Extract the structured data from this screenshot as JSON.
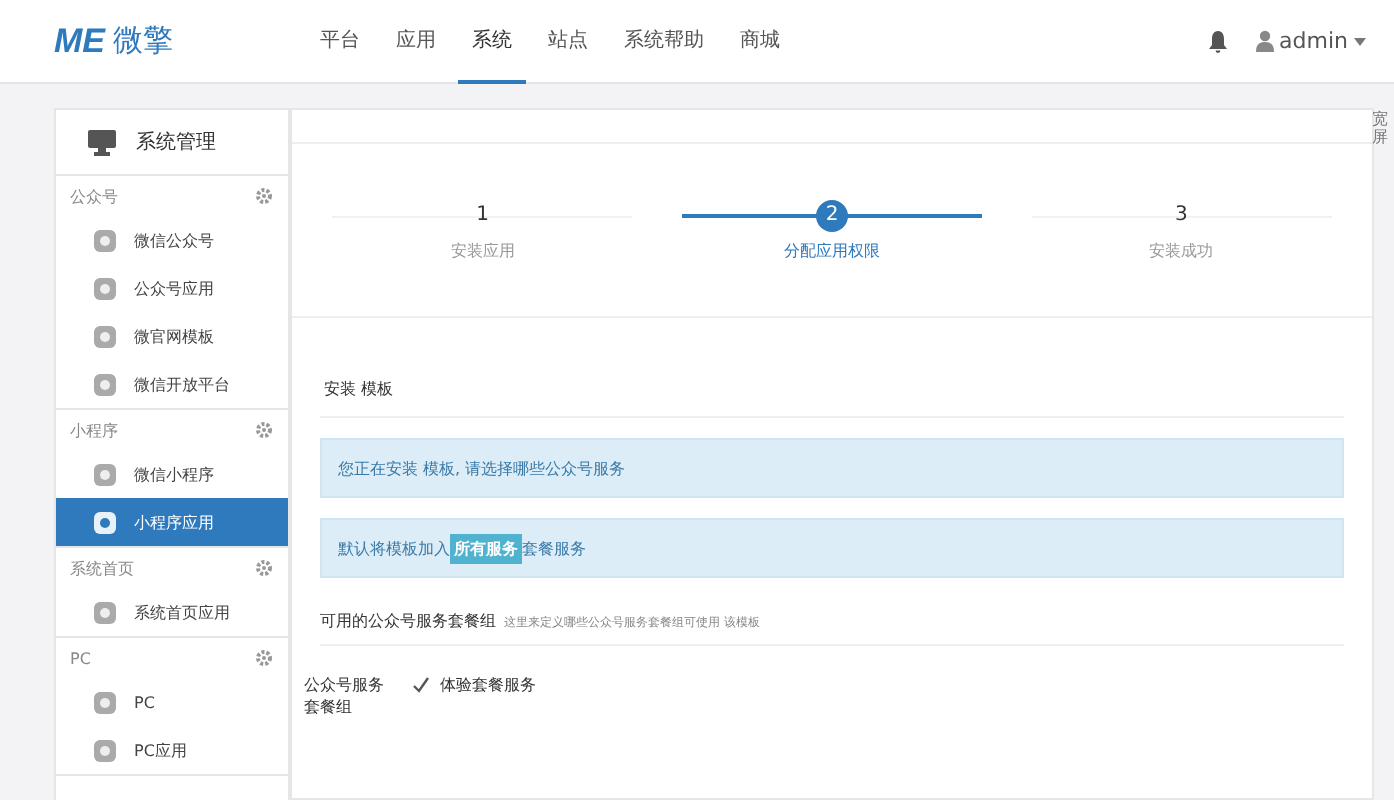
{
  "header": {
    "logo_mark": "ME",
    "logo_text": "微擎",
    "nav": [
      {
        "label": "平台",
        "selected": false
      },
      {
        "label": "应用",
        "selected": false
      },
      {
        "label": "系统",
        "selected": true
      },
      {
        "label": "站点",
        "selected": false
      },
      {
        "label": "系统帮助",
        "selected": false
      },
      {
        "label": "商城",
        "selected": false
      }
    ],
    "user": "admin"
  },
  "sidebar": {
    "title": "系统管理",
    "groups": [
      {
        "title": "公众号",
        "items": [
          {
            "label": "微信公众号",
            "selected": false
          },
          {
            "label": "公众号应用",
            "selected": false
          },
          {
            "label": "微官网模板",
            "selected": false
          },
          {
            "label": "微信开放平台",
            "selected": false
          }
        ]
      },
      {
        "title": "小程序",
        "items": [
          {
            "label": "微信小程序",
            "selected": false
          },
          {
            "label": "小程序应用",
            "selected": true
          }
        ]
      },
      {
        "title": "系统首页",
        "items": [
          {
            "label": "系统首页应用",
            "selected": false
          }
        ]
      },
      {
        "title": "PC",
        "items": [
          {
            "label": "PC",
            "selected": false
          },
          {
            "label": "PC应用",
            "selected": false
          }
        ]
      }
    ]
  },
  "steps": [
    {
      "number": "1",
      "label": "安装应用",
      "selected": false
    },
    {
      "number": "2",
      "label": "分配应用权限",
      "selected": true
    },
    {
      "number": "3",
      "label": "安装成功",
      "selected": false
    }
  ],
  "section_title": "安装 模板",
  "notice": "您正在安装 模板, 请选择哪些公众号服务",
  "default_notice": {
    "before": "默认将模板加入",
    "badge": "所有服务",
    "after": "套餐服务"
  },
  "packages": {
    "title": "可用的公众号服务套餐组",
    "hint": "这里来定义哪些公众号服务套餐组可使用 该模板",
    "label": "公众号服务套餐组",
    "options": [
      {
        "label": "体验套餐服务",
        "checked": true
      }
    ]
  },
  "side_tab": "宽屏"
}
